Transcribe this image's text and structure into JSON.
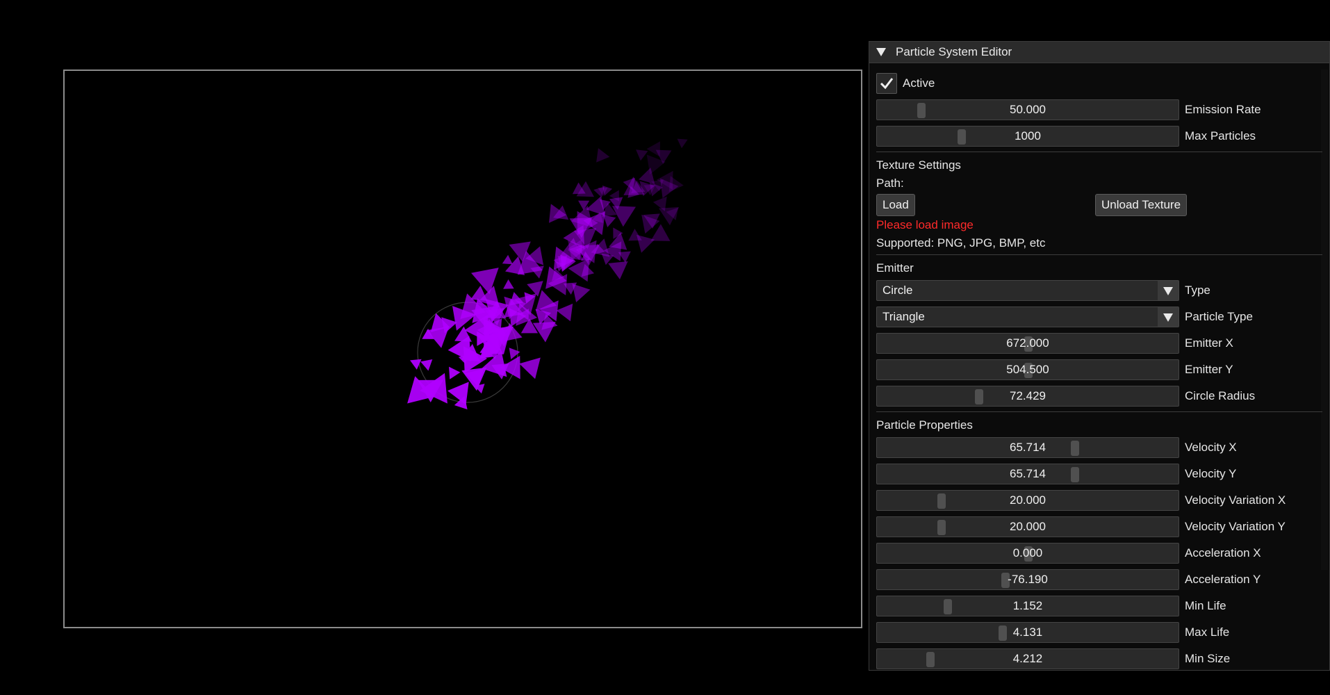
{
  "panel": {
    "title": "Particle System Editor",
    "active_label": "Active",
    "active_checked": true,
    "emission_rate": {
      "value": "50.000",
      "label": "Emission Rate",
      "fraction": 0.13
    },
    "max_particles": {
      "value": "1000",
      "label": "Max Particles",
      "fraction": 0.27
    },
    "texture": {
      "heading": "Texture Settings",
      "path_label": "Path:",
      "load_button": "Load",
      "unload_button": "Unload Texture",
      "warning": "Please load image",
      "supported": "Supported: PNG, JPG, BMP, etc"
    },
    "emitter": {
      "heading": "Emitter",
      "type": {
        "value": "Circle",
        "label": "Type"
      },
      "particle_type": {
        "value": "Triangle",
        "label": "Particle Type"
      },
      "emitter_x": {
        "value": "672.000",
        "label": "Emitter X",
        "fraction": 0.5
      },
      "emitter_y": {
        "value": "504.500",
        "label": "Emitter Y",
        "fraction": 0.5
      },
      "circle_radius": {
        "value": "72.429",
        "label": "Circle Radius",
        "fraction": 0.33
      }
    },
    "particle": {
      "heading": "Particle Properties",
      "velocity_x": {
        "value": "65.714",
        "label": "Velocity X",
        "fraction": 0.66
      },
      "velocity_y": {
        "value": "65.714",
        "label": "Velocity Y",
        "fraction": 0.66
      },
      "velocity_var_x": {
        "value": "20.000",
        "label": "Velocity Variation X",
        "fraction": 0.2
      },
      "velocity_var_y": {
        "value": "20.000",
        "label": "Velocity Variation Y",
        "fraction": 0.2
      },
      "accel_x": {
        "value": "0.000",
        "label": "Acceleration X",
        "fraction": 0.5
      },
      "accel_y": {
        "value": "-76.190",
        "label": "Acceleration Y",
        "fraction": 0.42
      },
      "min_life": {
        "value": "1.152",
        "label": "Min Life",
        "fraction": 0.22
      },
      "max_life": {
        "value": "4.131",
        "label": "Max Life",
        "fraction": 0.41
      },
      "min_size": {
        "value": "4.212",
        "label": "Min Size",
        "fraction": 0.16
      }
    }
  },
  "colors": {
    "particle": "#b000ff",
    "particle_dim": "#5a0d8a",
    "warning": "#ff2a2a",
    "panel_bg": "#0b0b0b"
  }
}
